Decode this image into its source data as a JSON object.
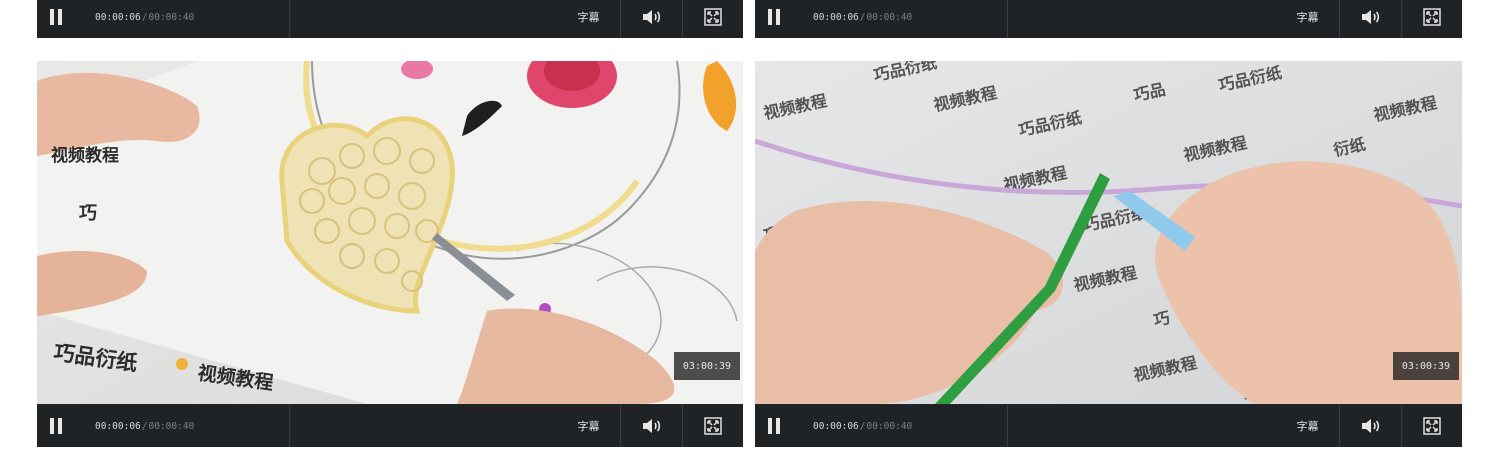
{
  "players": [
    {
      "id": "top-left",
      "current_time": "00:00:06",
      "separator": "/",
      "duration": "00:00:40",
      "subtitle_label": "字幕"
    },
    {
      "id": "top-right",
      "current_time": "00:00:06",
      "separator": "/",
      "duration": "00:00:40",
      "subtitle_label": "字幕"
    },
    {
      "id": "bottom-left",
      "current_time": "00:00:06",
      "separator": "/",
      "duration": "00:00:40",
      "subtitle_label": "字幕",
      "duration_badge": "03:00:39"
    },
    {
      "id": "bottom-right",
      "current_time": "00:00:06",
      "separator": "/",
      "duration": "00:00:40",
      "subtitle_label": "字幕",
      "duration_badge": "03:00:39"
    }
  ],
  "icons": {
    "pause": "pause-icon",
    "volume": "speaker-icon",
    "fullscreen": "fullscreen-icon"
  },
  "colors": {
    "control_bar": "#202326",
    "player_bg": "#23262a",
    "text_primary": "#d8d8d8",
    "text_muted": "#7c8086"
  },
  "watermark": {
    "brand": "巧品衍纸",
    "subtitle": "视频教程"
  }
}
